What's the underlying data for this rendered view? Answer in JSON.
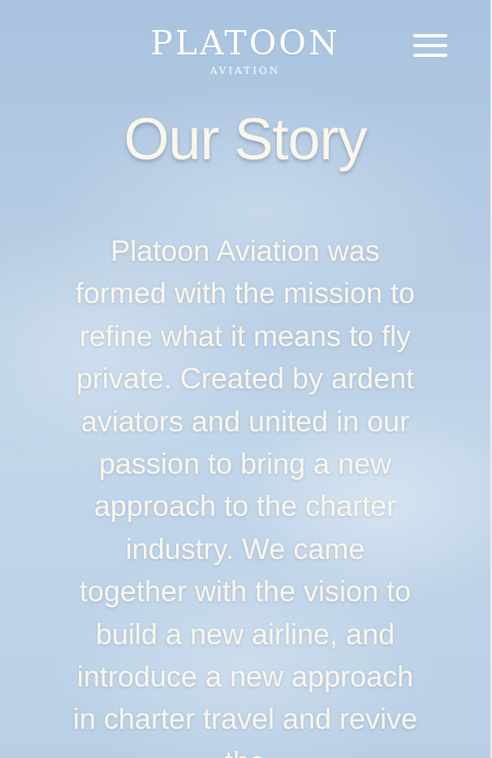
{
  "header": {
    "logo_main": "PLATOON",
    "logo_sub": "AVIATION",
    "menu_icon": "hamburger-menu-icon"
  },
  "hero": {
    "title": "Our Story"
  },
  "story": {
    "text": "Platoon Aviation was formed with the mission to refine what it means to fly private. Created by ardent aviators and united in our passion to bring a new approach to the charter industry. We came together with the vision to build a new airline, and introduce a new approach in charter travel and revive the"
  },
  "colors": {
    "sky_top": "#a9c3df",
    "sky_bottom": "#b9cfe6",
    "text_cream": "#fbf6ea",
    "logo_white": "#ffffff"
  }
}
